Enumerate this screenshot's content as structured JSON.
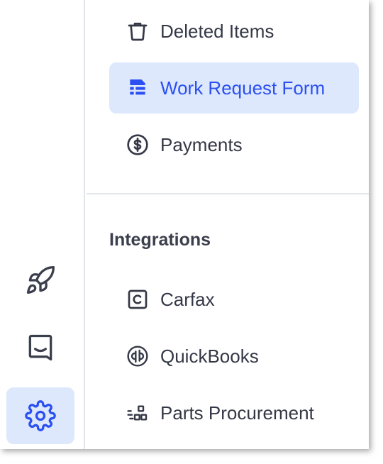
{
  "menu": {
    "items": [
      {
        "label": "Deleted Items",
        "icon": "trash-icon"
      },
      {
        "label": "Work Request Form",
        "icon": "form-icon",
        "active": true
      },
      {
        "label": "Payments",
        "icon": "dollar-circle-icon"
      }
    ]
  },
  "integrations": {
    "title": "Integrations",
    "items": [
      {
        "label": "Carfax",
        "icon": "carfax-icon"
      },
      {
        "label": "QuickBooks",
        "icon": "quickbooks-icon"
      },
      {
        "label": "Parts Procurement",
        "icon": "parts-procurement-icon"
      }
    ]
  },
  "rail": {
    "items": [
      {
        "icon": "rocket-icon"
      },
      {
        "icon": "inbox-icon"
      },
      {
        "icon": "gear-icon",
        "active": true
      }
    ]
  },
  "colors": {
    "accent": "#2b4ff0",
    "active_bg": "#dde8fd",
    "text": "#343846",
    "divider": "#e3e5ec"
  }
}
